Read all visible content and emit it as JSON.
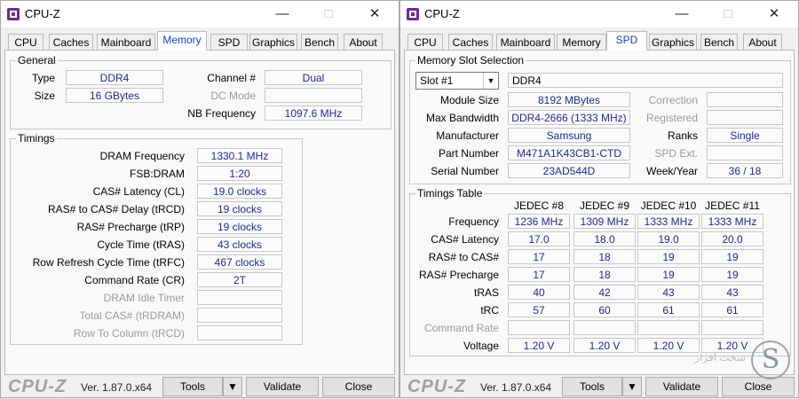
{
  "left": {
    "title": "CPU-Z",
    "tabs": [
      "CPU",
      "Caches",
      "Mainboard",
      "Memory",
      "SPD",
      "Graphics",
      "Bench",
      "About"
    ],
    "active_tab": "Memory",
    "general": {
      "label": "General",
      "type_label": "Type",
      "type": "DDR4",
      "size_label": "Size",
      "size": "16 GBytes",
      "channel_label": "Channel #",
      "channel": "Dual",
      "dcmode_label": "DC Mode",
      "dcmode": "",
      "nbfreq_label": "NB Frequency",
      "nbfreq": "1097.6 MHz"
    },
    "timings": {
      "label": "Timings",
      "rows": [
        {
          "label": "DRAM Frequency",
          "value": "1330.1 MHz"
        },
        {
          "label": "FSB:DRAM",
          "value": "1:20"
        },
        {
          "label": "CAS# Latency (CL)",
          "value": "19.0 clocks"
        },
        {
          "label": "RAS# to CAS# Delay (tRCD)",
          "value": "19 clocks"
        },
        {
          "label": "RAS# Precharge (tRP)",
          "value": "19 clocks"
        },
        {
          "label": "Cycle Time (tRAS)",
          "value": "43 clocks"
        },
        {
          "label": "Row Refresh Cycle Time (tRFC)",
          "value": "467 clocks"
        },
        {
          "label": "Command Rate (CR)",
          "value": "2T"
        },
        {
          "label": "DRAM Idle Timer",
          "value": ""
        },
        {
          "label": "Total CAS# (tRDRAM)",
          "value": ""
        },
        {
          "label": "Row To Column (tRCD)",
          "value": ""
        }
      ]
    }
  },
  "right": {
    "title": "CPU-Z",
    "tabs": [
      "CPU",
      "Caches",
      "Mainboard",
      "Memory",
      "SPD",
      "Graphics",
      "Bench",
      "About"
    ],
    "active_tab": "SPD",
    "slot": {
      "label": "Memory Slot Selection",
      "selected": "Slot #1",
      "type": "DDR4",
      "module_size_label": "Module Size",
      "module_size": "8192 MBytes",
      "max_bw_label": "Max Bandwidth",
      "max_bw": "DDR4-2666 (1333 MHz)",
      "manufacturer_label": "Manufacturer",
      "manufacturer": "Samsung",
      "part_label": "Part Number",
      "part": "M471A1K43CB1-CTD",
      "serial_label": "Serial Number",
      "serial": "23AD544D",
      "correction_label": "Correction",
      "correction": "",
      "registered_label": "Registered",
      "registered": "",
      "ranks_label": "Ranks",
      "ranks": "Single",
      "spdext_label": "SPD Ext.",
      "spdext": "",
      "weekyear_label": "Week/Year",
      "weekyear": "36 / 18"
    },
    "timings_table": {
      "label": "Timings Table",
      "columns": [
        "JEDEC #8",
        "JEDEC #9",
        "JEDEC #10",
        "JEDEC #11"
      ],
      "rows": [
        {
          "label": "Frequency",
          "values": [
            "1236 MHz",
            "1309 MHz",
            "1333 MHz",
            "1333 MHz"
          ]
        },
        {
          "label": "CAS# Latency",
          "values": [
            "17.0",
            "18.0",
            "19.0",
            "20.0"
          ]
        },
        {
          "label": "RAS# to CAS#",
          "values": [
            "17",
            "18",
            "19",
            "19"
          ]
        },
        {
          "label": "RAS# Precharge",
          "values": [
            "17",
            "18",
            "19",
            "19"
          ]
        },
        {
          "label": "tRAS",
          "values": [
            "40",
            "42",
            "43",
            "43"
          ]
        },
        {
          "label": "tRC",
          "values": [
            "57",
            "60",
            "61",
            "61"
          ]
        },
        {
          "label": "Command Rate",
          "values": [
            "",
            "",
            "",
            ""
          ]
        },
        {
          "label": "Voltage",
          "values": [
            "1.20 V",
            "1.20 V",
            "1.20 V",
            "1.20 V"
          ]
        }
      ]
    }
  },
  "footer": {
    "logo": "CPU-Z",
    "version": "Ver. 1.87.0.x64",
    "tools_label": "Tools",
    "validate_label": "Validate",
    "close_label": "Close"
  },
  "watermark": {
    "letter": "S",
    "text": "سخت افزار"
  },
  "colors": {
    "value_text": "#1e2a92",
    "active_tab_text": "#1a3fc0"
  }
}
